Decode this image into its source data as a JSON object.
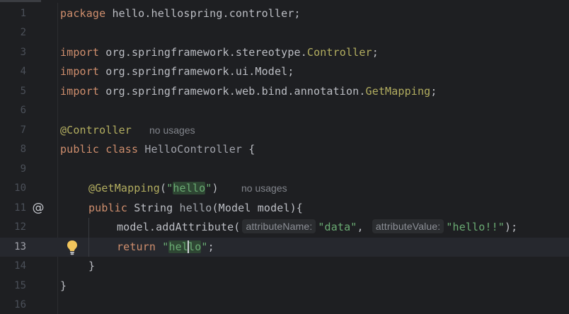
{
  "editor": {
    "language": "Java",
    "current_line": 13,
    "lines": [
      {
        "n": "1"
      },
      {
        "n": "2"
      },
      {
        "n": "3"
      },
      {
        "n": "4"
      },
      {
        "n": "5"
      },
      {
        "n": "6"
      },
      {
        "n": "7"
      },
      {
        "n": "8"
      },
      {
        "n": "9"
      },
      {
        "n": "10"
      },
      {
        "n": "11"
      },
      {
        "n": "12"
      },
      {
        "n": "13"
      },
      {
        "n": "14"
      },
      {
        "n": "15"
      },
      {
        "n": "16"
      }
    ],
    "code": {
      "l1_kw": "package",
      "l1_rest": " hello.hellospring.controller;",
      "l3_kw": "import",
      "l3_pkg": " org.springframework.stereotype.",
      "l3_cls": "Controller",
      "l3_end": ";",
      "l4_kw": "import",
      "l4_rest": " org.springframework.ui.Model;",
      "l5_kw": "import",
      "l5_pkg": " org.springframework.web.bind.annotation.",
      "l5_cls": "GetMapping",
      "l5_end": ";",
      "l7_ann": "@Controller",
      "l7_usages": "no usages",
      "l8_kw": "public class",
      "l8_name": "HelloController",
      "l8_brace": " {",
      "l10_ann": "@GetMapping",
      "l10_open": "(",
      "l10_q1": "\"",
      "l10_str": "hello",
      "l10_q2": "\"",
      "l10_close": ")",
      "l10_usages": "no usages",
      "l11_kw": "public",
      "l11_type": " String ",
      "l11_name": "hello",
      "l11_params": "(Model model){",
      "l12_call": "model.addAttribute(",
      "l12_hint1": "attributeName:",
      "l12_str1": "\"data\"",
      "l12_comma": ",",
      "l12_hint2": "attributeValue:",
      "l12_str2": "\"hello!!\"",
      "l12_end": ");",
      "l13_kw": "return",
      "l13_q1": " \"",
      "l13_str_a": "hel",
      "l13_str_b": "lo",
      "l13_q2": "\"",
      "l13_end": ";",
      "l14": "}",
      "l15": "}"
    },
    "gutter_icons": {
      "line11": "@",
      "line13": "lightbulb-icon"
    },
    "colors": {
      "background": "#1e1f22",
      "keyword": "#cf8e6d",
      "annotation": "#b3ae60",
      "string": "#6aab73",
      "text": "#bcbec4",
      "current_line": "#26282e"
    }
  }
}
